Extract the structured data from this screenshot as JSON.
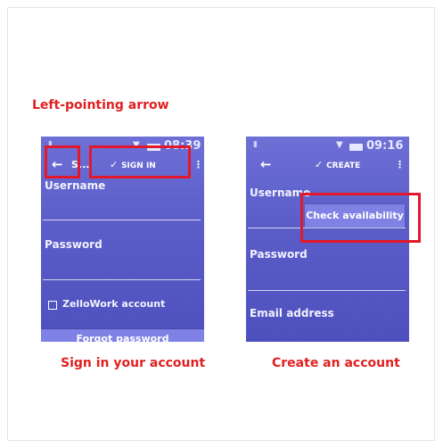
{
  "annotation": {
    "arrow_caption": "Left-pointing arrow"
  },
  "signin_screen": {
    "status_time": "08:39",
    "back_icon": "←",
    "truncated_title": "S...",
    "signin_button_label": "SIGN IN",
    "menu_icon": "⋮",
    "username_label": "Username",
    "password_label": "Password",
    "checkbox_label": "ZelloWork account",
    "forgot_password_label": "Forgot password",
    "caption": "Sign in your account"
  },
  "create_screen": {
    "status_time": "09:16",
    "back_icon": "←",
    "create_button_label": "CREATE",
    "menu_icon": "⋮",
    "username_label": "Username",
    "check_availability_label": "Check availability",
    "password_label": "Password",
    "email_label": "Email address",
    "caption": "Create an account"
  },
  "colors": {
    "highlight_red": "#e01a2a",
    "caption_red": "#e02020",
    "screen_blue": "#5a5cc8"
  }
}
